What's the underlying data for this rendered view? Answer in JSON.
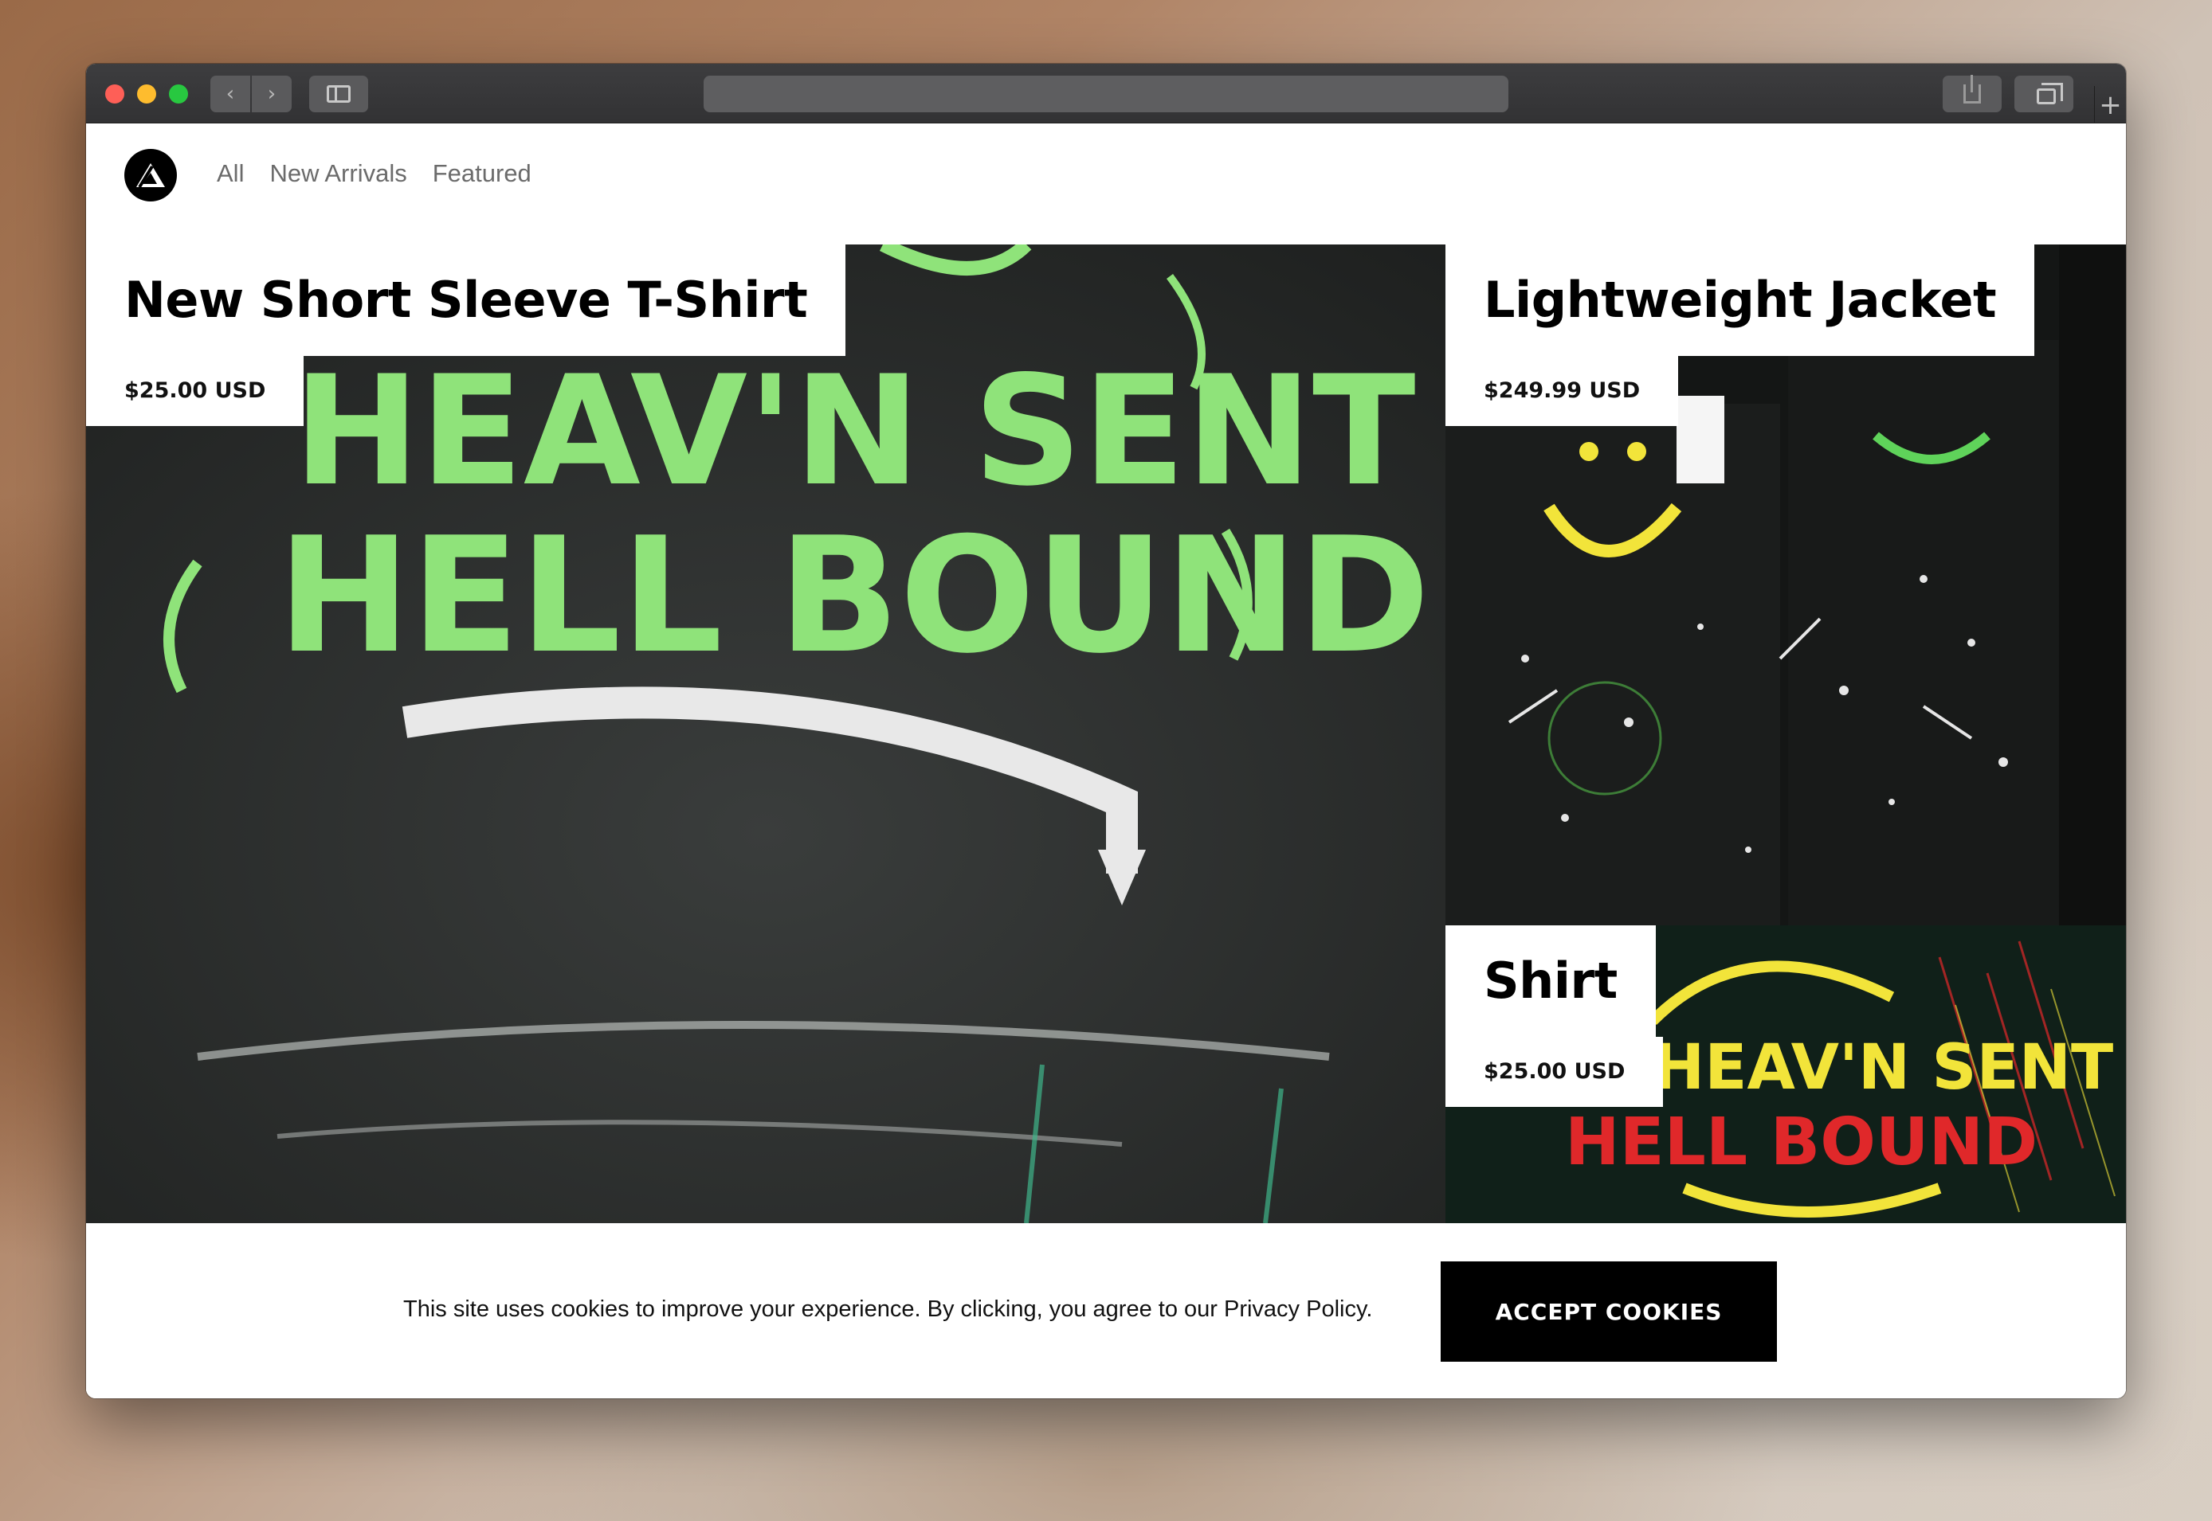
{
  "browser": {
    "back_icon": "chevron-left-icon",
    "forward_icon": "chevron-right-icon",
    "sidebar_icon": "sidebar-icon",
    "share_icon": "share-icon",
    "tabs_icon": "tabs-overview-icon",
    "new_tab_label": "+"
  },
  "nav": {
    "logo_icon": "triangle-logo-icon",
    "links": [
      "All",
      "New Arrivals",
      "Featured"
    ]
  },
  "products": [
    {
      "title": "New Short Sleeve T-Shirt",
      "price": "$25.00 USD",
      "image_text": [
        "HEAV'N SENT",
        "HELL BOUND"
      ]
    },
    {
      "title": "Lightweight Jacket",
      "price": "$249.99 USD"
    },
    {
      "title": "Shirt",
      "price": "$25.00 USD",
      "image_text": [
        "HEAV'N SENT",
        "HELL BOUND"
      ]
    }
  ],
  "cookie_banner": {
    "message": "This site uses cookies to improve your experience. By clicking, you agree to our Privacy Policy.",
    "button": "ACCEPT COOKIES"
  },
  "colors": {
    "accent_green": "#8fe37a",
    "accent_yellow": "#f2e43a",
    "accent_red": "#e0282a",
    "button_bg": "#000000"
  }
}
